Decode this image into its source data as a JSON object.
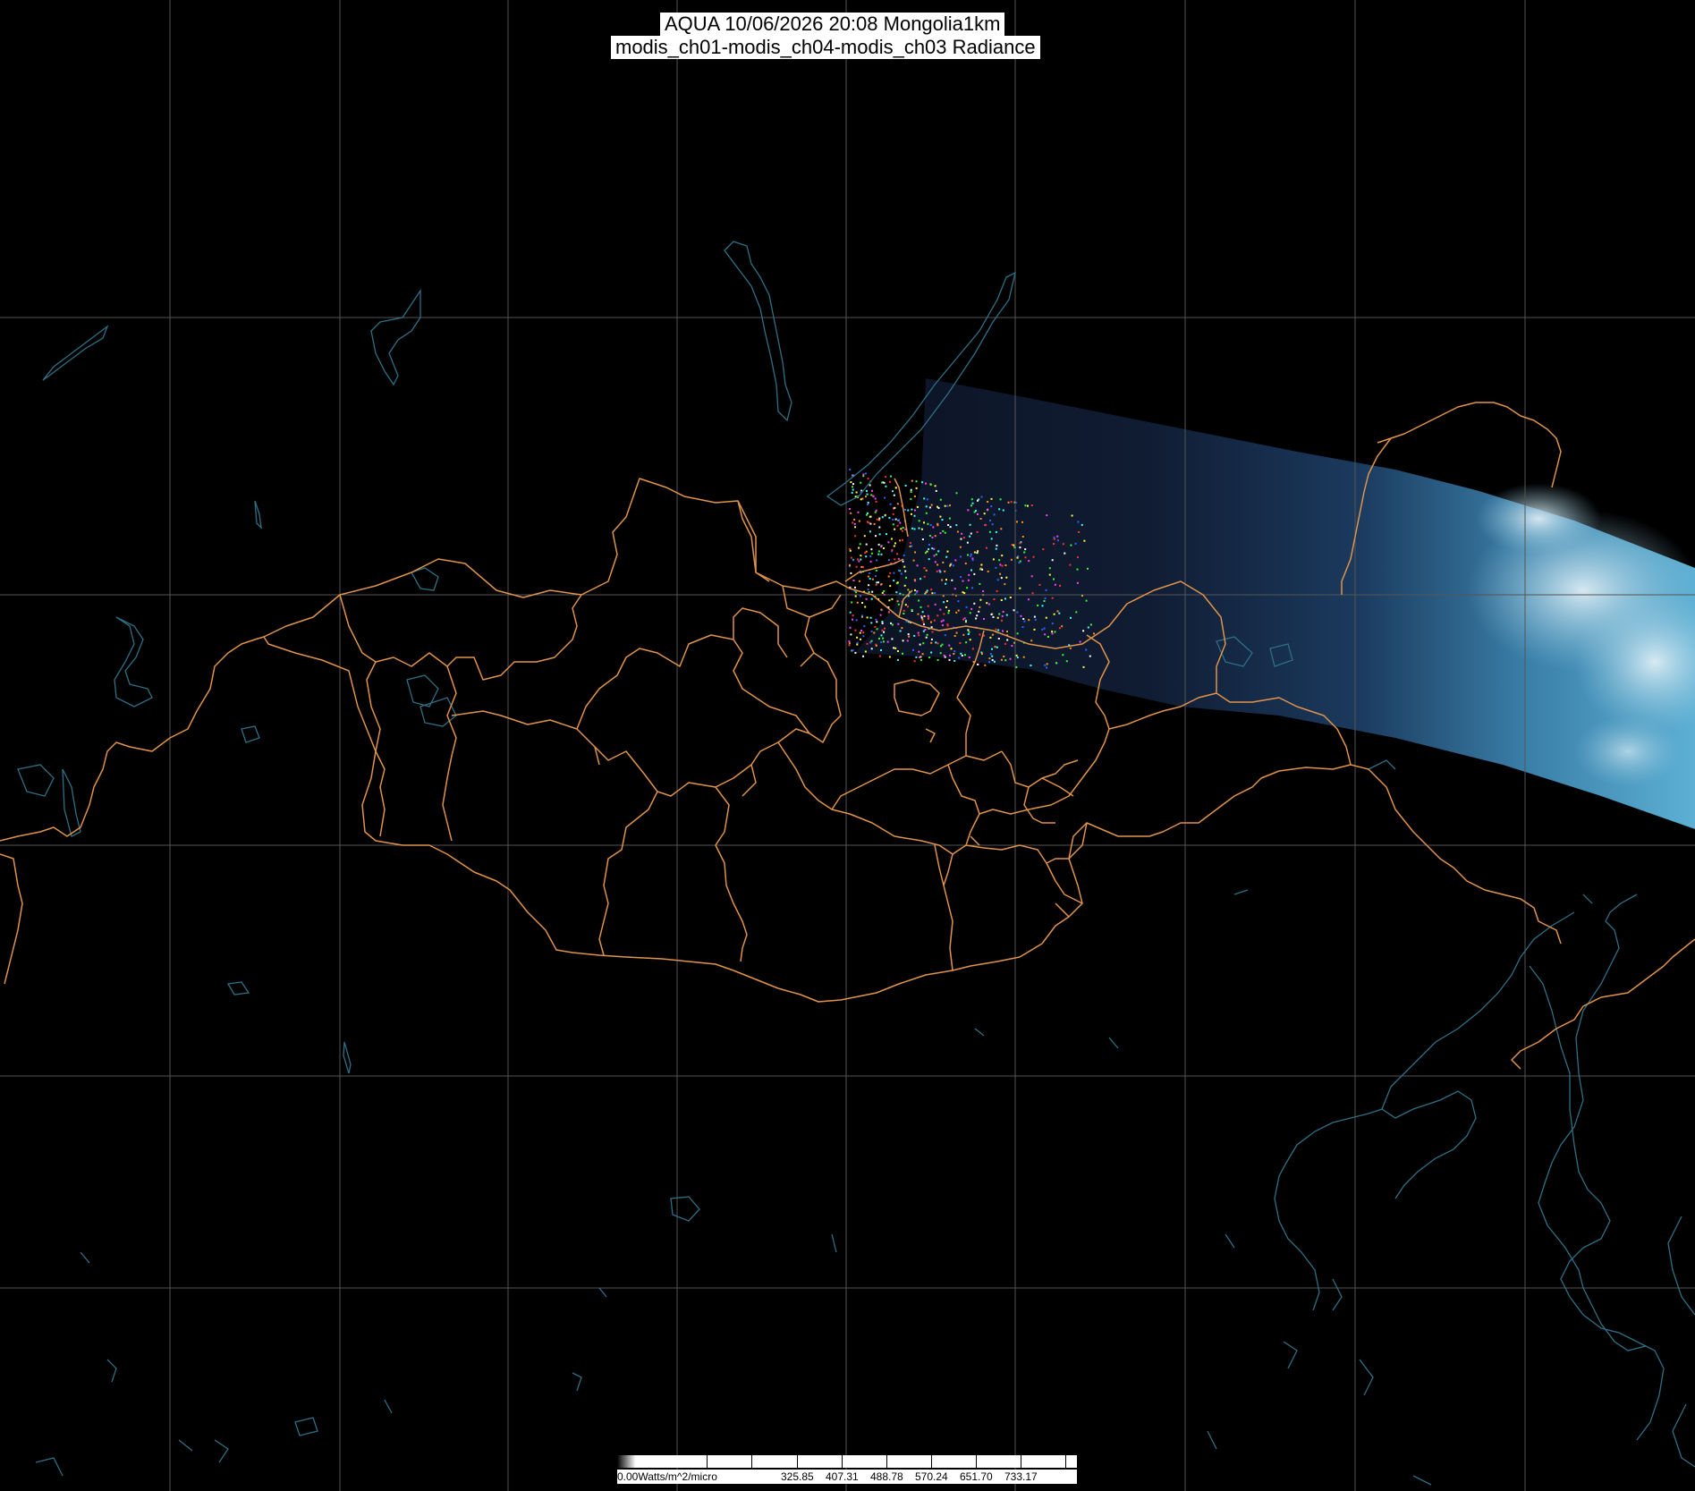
{
  "title": {
    "line1": "AQUA 10/06/2026 20:08 Mongolia1km",
    "line2": "modis_ch01-modis_ch04-modis_ch03 Radiance"
  },
  "legend": {
    "unit_label": "0.00Watts/m^2/micro",
    "values": [
      "325.85",
      "407.31",
      "488.78",
      "570.24",
      "651.70",
      "733.17"
    ]
  },
  "colors": {
    "background": "#000000",
    "graticule": "#555555",
    "borders": "#e0944a",
    "coastlines": "#2f6f86",
    "swath_dark": "#0f1a2e",
    "swath_light": "#4a9ec4"
  }
}
